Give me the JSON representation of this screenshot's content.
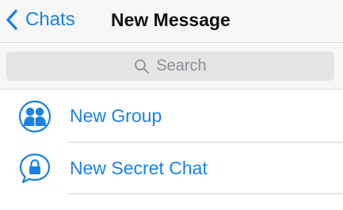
{
  "navbar": {
    "back_label": "Chats",
    "title": "New Message"
  },
  "search": {
    "placeholder": "Search"
  },
  "rows": [
    {
      "label": "New Group",
      "icon": "group-icon"
    },
    {
      "label": "New Secret Chat",
      "icon": "secret-chat-lock-icon"
    }
  ],
  "colors": {
    "accent": "#1a82e3",
    "title": "#111111",
    "navbar_bg": "#f7f7f8",
    "search_field_bg": "#e4e4e6",
    "placeholder": "#8e8e93"
  }
}
